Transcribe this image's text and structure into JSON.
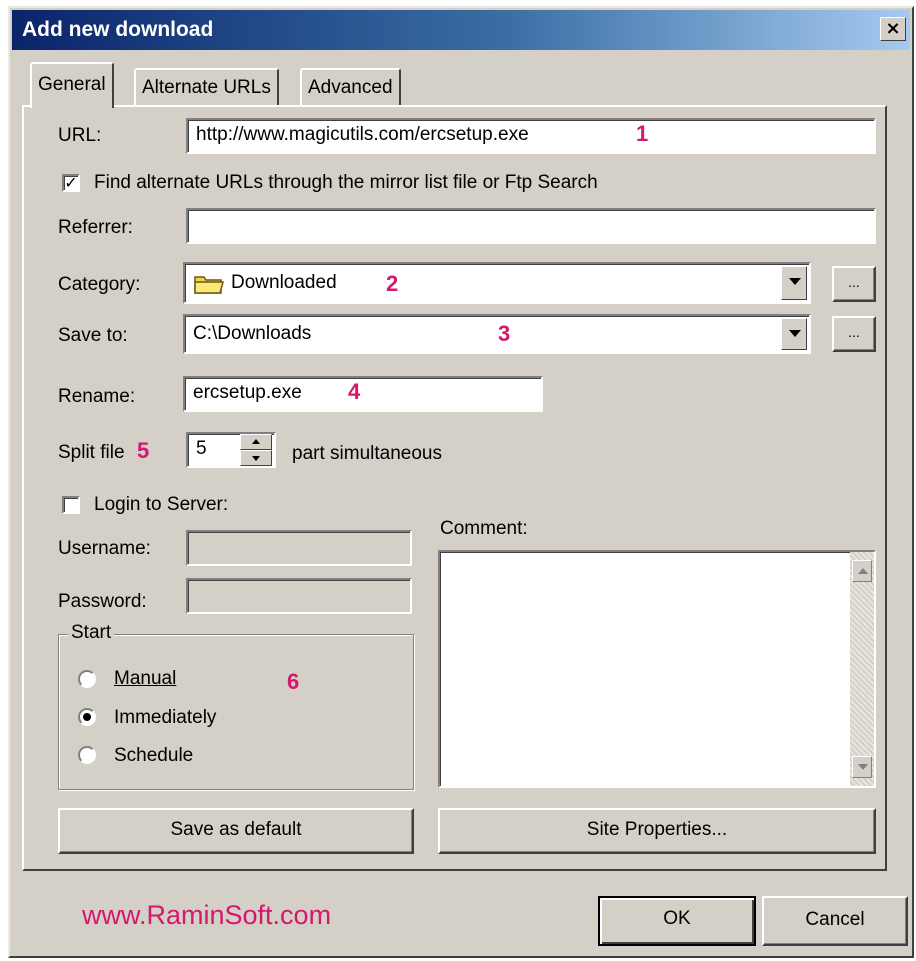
{
  "window": {
    "title": "Add new download",
    "close": "×"
  },
  "tabs": [
    {
      "label": "General",
      "active": true
    },
    {
      "label": "Alternate URLs",
      "active": false
    },
    {
      "label": "Advanced",
      "active": false
    }
  ],
  "general": {
    "url": {
      "label": "URL:",
      "value": "http://www.magicutils.com/ercsetup.exe"
    },
    "find_alternate": {
      "label": "Find alternate URLs through the mirror list file or Ftp Search",
      "checked": true,
      "mark": "✓"
    },
    "referrer": {
      "label": "Referrer:",
      "value": ""
    },
    "category": {
      "label": "Category:",
      "value": "Downloaded",
      "icon": "folder-icon",
      "browse": "..."
    },
    "save_to": {
      "label": "Save to:",
      "value": "C:\\Downloads",
      "browse": "..."
    },
    "rename": {
      "label": "Rename:",
      "value": "ercsetup.exe"
    },
    "split": {
      "label": "Split file",
      "value": "5",
      "suffix": "part simultaneous"
    },
    "login": {
      "label": "Login to Server:",
      "checked": false
    },
    "username": {
      "label": "Username:",
      "value": ""
    },
    "password": {
      "label": "Password:",
      "value": ""
    },
    "comment": {
      "label": "Comment:",
      "value": ""
    },
    "start": {
      "legend": "Start",
      "options": [
        {
          "label": "Manual",
          "checked": false
        },
        {
          "label": "Immediately",
          "checked": true
        },
        {
          "label": "Schedule",
          "checked": false
        }
      ]
    },
    "save_default_label": "Save as default",
    "site_properties_label": "Site Properties..."
  },
  "annotations": [
    "1",
    "2",
    "3",
    "4",
    "5",
    "6"
  ],
  "footer": {
    "watermark": "www.RaminSoft.com",
    "ok_label": "OK",
    "cancel_label": "Cancel"
  },
  "colors": {
    "face": "#d4d0c8",
    "title_start": "#0a246a",
    "title_end": "#a6caf0",
    "annotation": "#d6176e"
  }
}
